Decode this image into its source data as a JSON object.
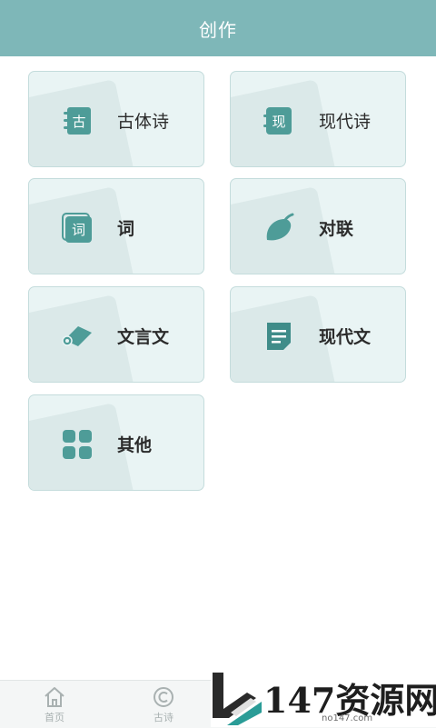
{
  "header": {
    "title": "创作"
  },
  "cards": [
    {
      "label": "古体诗",
      "icon": "notebook-gu-icon",
      "badge_char": "古"
    },
    {
      "label": "现代诗",
      "icon": "notebook-xian-icon",
      "badge_char": "现"
    },
    {
      "label": "词",
      "icon": "stacked-ci-icon",
      "badge_char": "词"
    },
    {
      "label": "对联",
      "icon": "leaf-icon"
    },
    {
      "label": "文言文",
      "icon": "scroll-icon"
    },
    {
      "label": "现代文",
      "icon": "document-lines-icon"
    },
    {
      "label": "其他",
      "icon": "grid-four-icon"
    }
  ],
  "tabbar": {
    "items": [
      {
        "label": "首页",
        "icon": "home-icon"
      },
      {
        "label": "古诗",
        "icon": "copyright-circle-icon"
      }
    ]
  },
  "watermark": {
    "text": "147资源网",
    "subtext": "no147.com"
  },
  "colors": {
    "header": "#7eb7b8",
    "icon": "#4e9c98",
    "card_bg": "#e9f4f4",
    "card_border": "#c4dcdc"
  }
}
